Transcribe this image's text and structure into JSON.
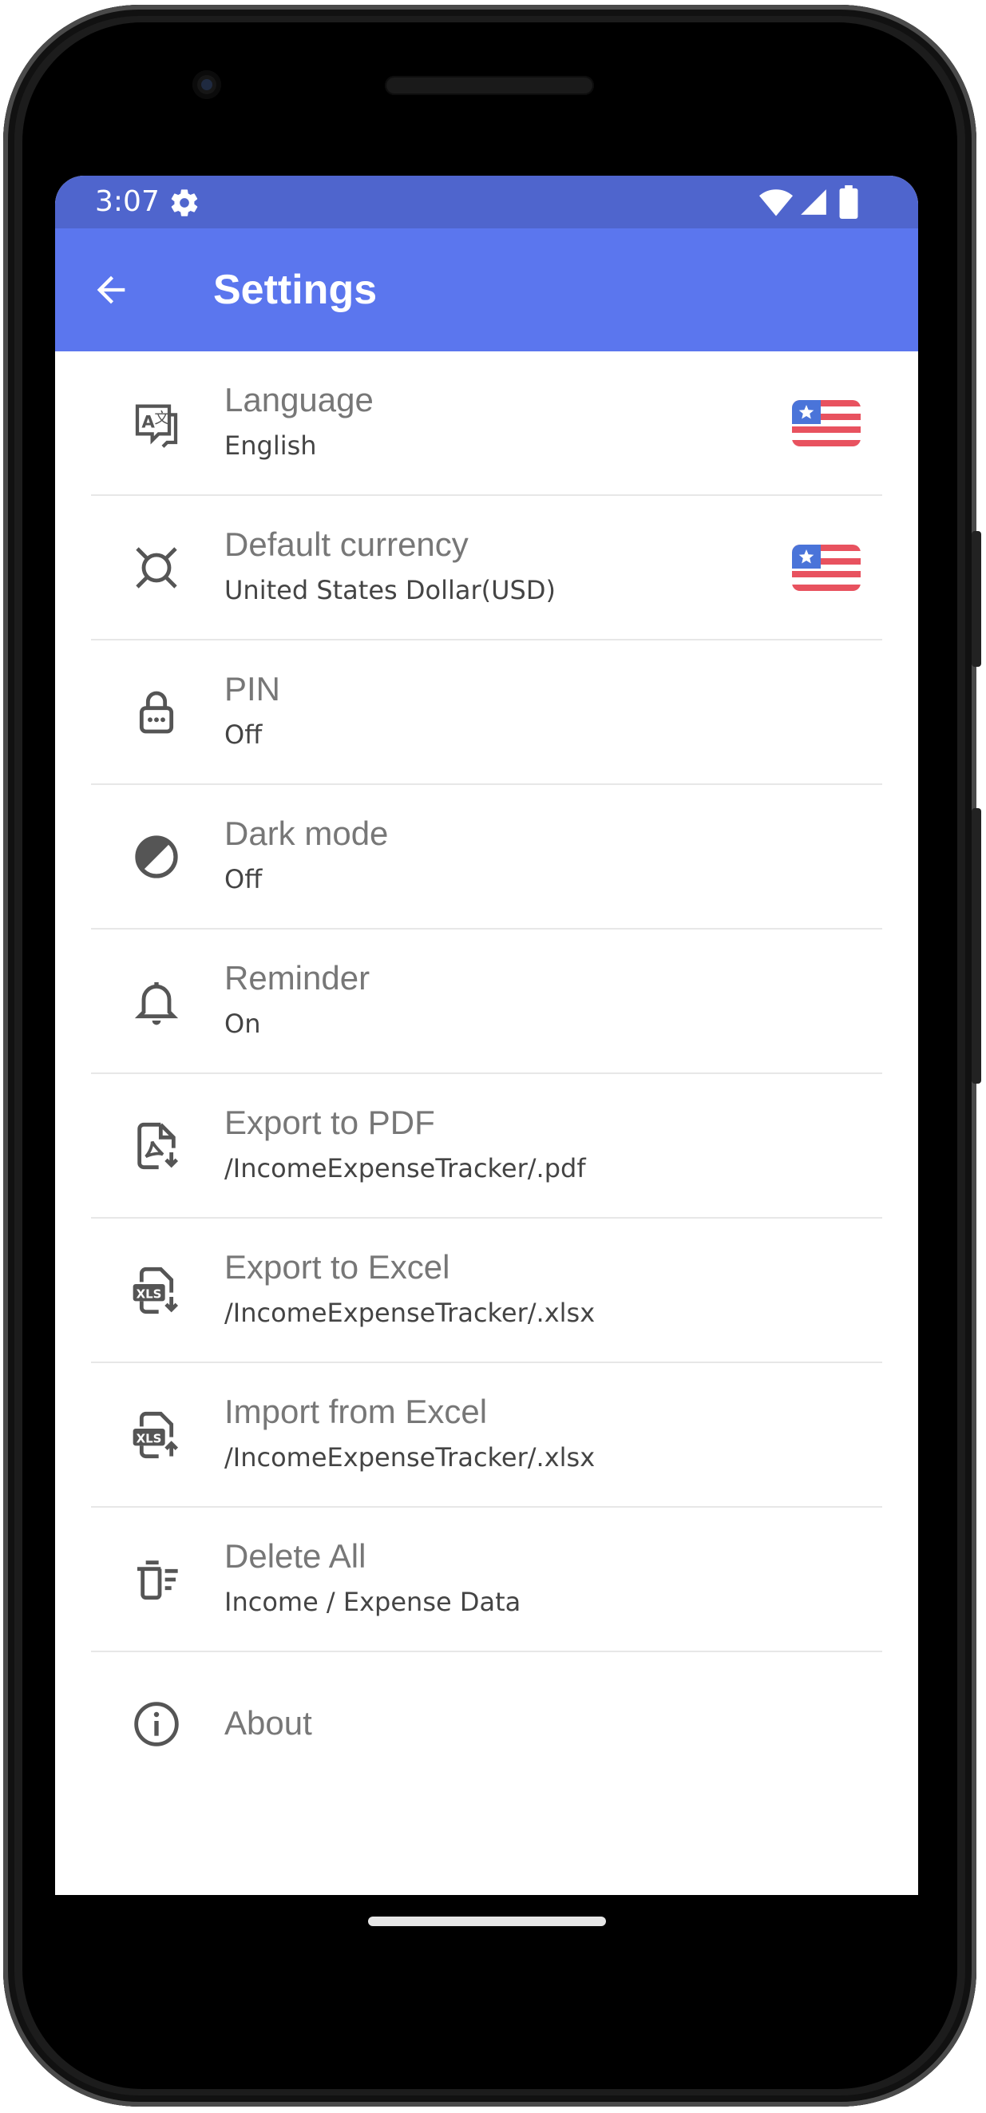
{
  "status_bar": {
    "time": "3:07",
    "icons": [
      "gear-icon",
      "wifi-icon",
      "signal-icon",
      "battery-icon"
    ],
    "background": "#4f65cd"
  },
  "app_bar": {
    "title": "Settings",
    "back_icon": "arrow-back-icon",
    "background": "#5b76ee"
  },
  "settings": [
    {
      "id": "language",
      "icon": "translate-icon",
      "title": "Language",
      "subtitle": "English",
      "flag": "us-flag-icon"
    },
    {
      "id": "currency",
      "icon": "currency-icon",
      "title": "Default currency",
      "subtitle": "United States Dollar(USD)",
      "flag": "us-flag-icon"
    },
    {
      "id": "pin",
      "icon": "lock-icon",
      "title": "PIN",
      "subtitle": "Off"
    },
    {
      "id": "dark-mode",
      "icon": "contrast-icon",
      "title": "Dark mode",
      "subtitle": "Off"
    },
    {
      "id": "reminder",
      "icon": "bell-icon",
      "title": "Reminder",
      "subtitle": "On"
    },
    {
      "id": "export-pdf",
      "icon": "pdf-export-icon",
      "title": "Export to PDF",
      "subtitle": "/IncomeExpenseTracker/.pdf"
    },
    {
      "id": "export-excel",
      "icon": "xls-export-icon",
      "title": "Export to Excel",
      "subtitle": "/IncomeExpenseTracker/.xlsx"
    },
    {
      "id": "import-excel",
      "icon": "xls-import-icon",
      "title": "Import from Excel",
      "subtitle": "/IncomeExpenseTracker/.xlsx"
    },
    {
      "id": "delete-all",
      "icon": "delete-sweep-icon",
      "title": "Delete All",
      "subtitle": "Income / Expense Data"
    },
    {
      "id": "about",
      "icon": "info-icon",
      "title": "About"
    }
  ],
  "colors": {
    "icon": "#555555",
    "title": "#777777",
    "subtitle": "#444444",
    "divider": "#e7e7e7",
    "flag_red": "#e8525f",
    "flag_blue": "#4a74d9"
  }
}
